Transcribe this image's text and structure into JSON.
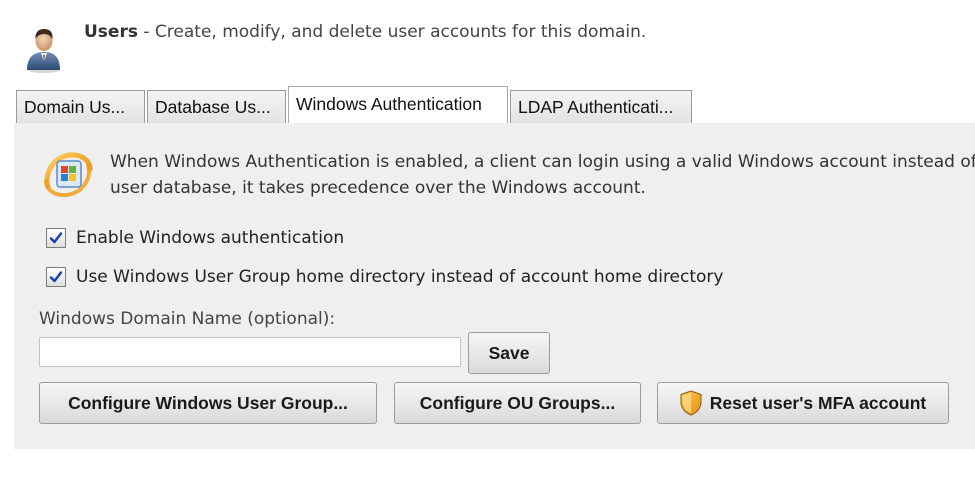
{
  "header": {
    "title": "Users",
    "description": " - Create, modify, and delete user accounts for this domain."
  },
  "tabs": [
    {
      "label": "Domain Us...",
      "active": false
    },
    {
      "label": "Database Us...",
      "active": false
    },
    {
      "label": "Windows Authentication",
      "active": true
    },
    {
      "label": "LDAP Authenticati...",
      "active": false
    }
  ],
  "panel": {
    "info_line1": "When Windows Authentication is enabled, a client can login using a valid Windows account instead of",
    "info_line2": "user database, it takes precedence over the Windows account.",
    "enable_auth": {
      "label": "Enable Windows authentication",
      "checked": true
    },
    "use_group_home": {
      "label": "Use Windows User Group home directory instead of account home directory",
      "checked": true
    },
    "domain_name": {
      "label": "Windows Domain Name (optional):",
      "value": "",
      "placeholder": ""
    },
    "save_label": "Save",
    "configure_group_label": "Configure Windows User Group...",
    "configure_ou_label": "Configure OU Groups...",
    "reset_mfa_label": "Reset user's MFA account"
  },
  "colors": {
    "panel_bg": "#efefef",
    "checkmark": "#1a3fb0",
    "shield": "#f5a623"
  }
}
